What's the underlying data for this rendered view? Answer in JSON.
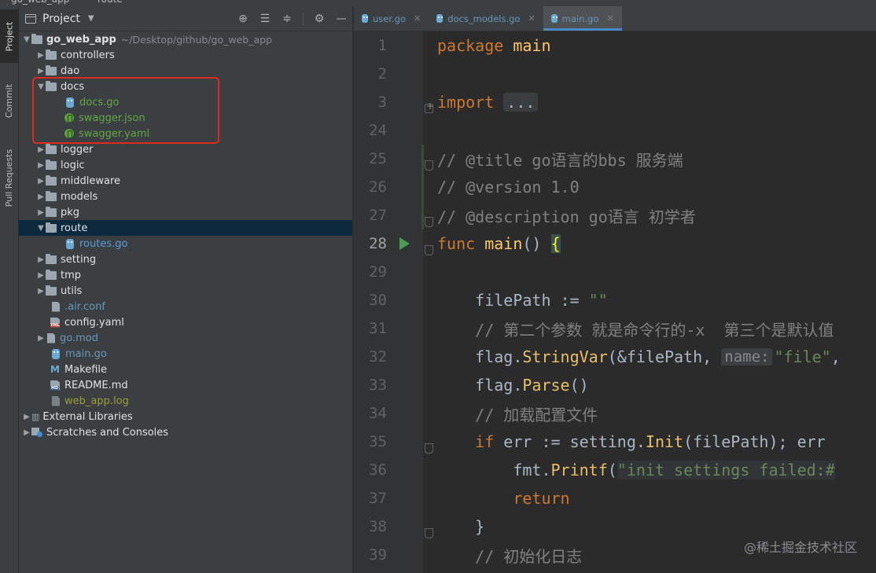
{
  "top_strip": {
    "left_text": "go_web_app",
    "right_text": "route"
  },
  "tool_strip": {
    "project_label": "Project",
    "commit_label": "Commit",
    "pull_label": "Pull Requests"
  },
  "project_panel": {
    "title": "Project"
  },
  "tree": {
    "root_name": "go_web_app",
    "root_path": "~/Desktop/github/go_web_app",
    "items": [
      {
        "label": "controllers"
      },
      {
        "label": "dao"
      },
      {
        "label": "docs"
      },
      {
        "label": "docs.go"
      },
      {
        "label": "swagger.json"
      },
      {
        "label": "swagger.yaml"
      },
      {
        "label": "logger"
      },
      {
        "label": "logic"
      },
      {
        "label": "middleware"
      },
      {
        "label": "models"
      },
      {
        "label": "pkg"
      },
      {
        "label": "route"
      },
      {
        "label": "routes.go"
      },
      {
        "label": "setting"
      },
      {
        "label": "tmp"
      },
      {
        "label": "utils"
      },
      {
        "label": ".air.conf"
      },
      {
        "label": "config.yaml"
      },
      {
        "label": "go.mod"
      },
      {
        "label": "main.go"
      },
      {
        "label": "Makefile"
      },
      {
        "label": "README.md"
      },
      {
        "label": "web_app.log"
      },
      {
        "label": "External Libraries"
      },
      {
        "label": "Scratches and Consoles"
      }
    ]
  },
  "tabs": [
    {
      "label": "user.go"
    },
    {
      "label": "docs_models.go"
    },
    {
      "label": "main.go"
    }
  ],
  "line_numbers": [
    "1",
    "2",
    "3",
    "24",
    "25",
    "26",
    "27",
    "28",
    "29",
    "30",
    "31",
    "32",
    "33",
    "34",
    "35",
    "36",
    "37",
    "38",
    "39"
  ],
  "code": {
    "l1_kw": "package",
    "l1_rest": " main",
    "l3_kw": "import",
    "l3_folded": "...",
    "l25": "// @title go语言的bbs 服务端",
    "l26": "// @version 1.0",
    "l27": "// @description go语言 初学者",
    "l28_kw": "func",
    "l28_fn": " main",
    "l28_paren": "() ",
    "l28_brace": "{",
    "l30_a": "    filePath := ",
    "l30_str": "\"\"",
    "l31": "    // 第二个参数 就是命令行的-x  第三个是默认值",
    "l32_a": "    flag.",
    "l32_call": "StringVar",
    "l32_b": "(&filePath, ",
    "l32_hint": "name:",
    "l32_str": "\"file\"",
    "l32_c": ",",
    "l33_a": "    flag.",
    "l33_call": "Parse",
    "l33_b": "()",
    "l34": "    // 加载配置文件",
    "l35_kw": "    if",
    "l35_a": " err := setting.",
    "l35_call": "Init",
    "l35_b": "(filePath); err",
    "l36_a": "        fmt.",
    "l36_call": "Printf",
    "l36_b": "(",
    "l36_str": "\"init settings failed:#",
    "l37_kw": "        return",
    "l38": "    }",
    "l39": "    // 初始化日志"
  },
  "watermark": "@稀土掘金技术社区",
  "colors": {
    "accent": "#4a88c7",
    "highlight_box": "#e0291d",
    "keyword": "#cc7832",
    "function": "#ffc66d",
    "comment": "#808080",
    "string": "#6a8759"
  }
}
